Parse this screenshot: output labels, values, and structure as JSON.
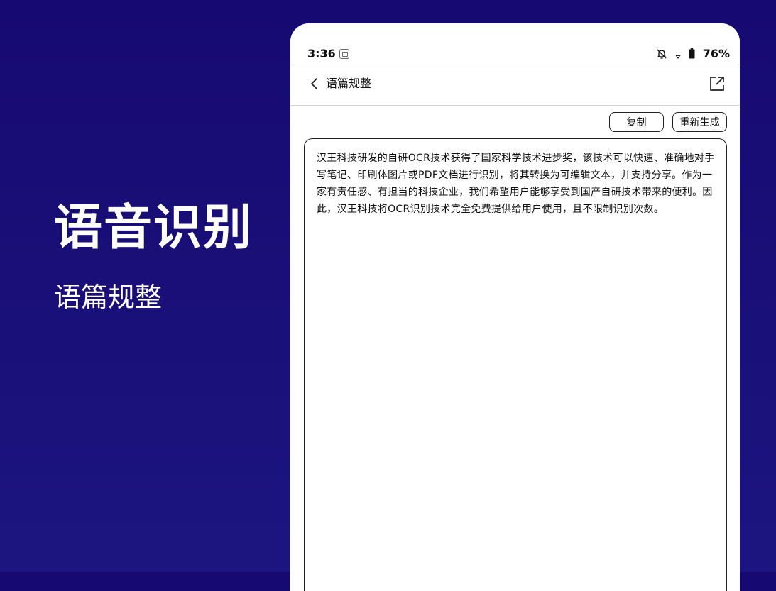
{
  "promo": {
    "title": "语音识别",
    "subtitle": "语篇规整"
  },
  "status_bar": {
    "time": "3:36",
    "battery": "76%",
    "icons": [
      "app-notification-icon",
      "bell-off-icon",
      "wifi-icon",
      "battery-icon"
    ]
  },
  "app_bar": {
    "title": "语篇规整",
    "back_icon": "chevron-left-icon",
    "share_icon": "share-external-icon"
  },
  "actions": {
    "copy_label": "复制",
    "regenerate_label": "重新生成"
  },
  "content": {
    "text": "汉王科技研发的自研OCR技术获得了国家科学技术进步奖，该技术可以快速、准确地对手写笔记、印刷体图片或PDF文档进行识别，将其转换为可编辑文本，并支持分享。作为一家有责任感、有担当的科技企业，我们希望用户能够享受到国产自研技术带来的便利。因此，汉王科技将OCR识别技术完全免费提供给用户使用，且不限制识别次数。"
  },
  "colors": {
    "background": "#1a0f78",
    "device": "#ffffff",
    "text": "#111111"
  }
}
